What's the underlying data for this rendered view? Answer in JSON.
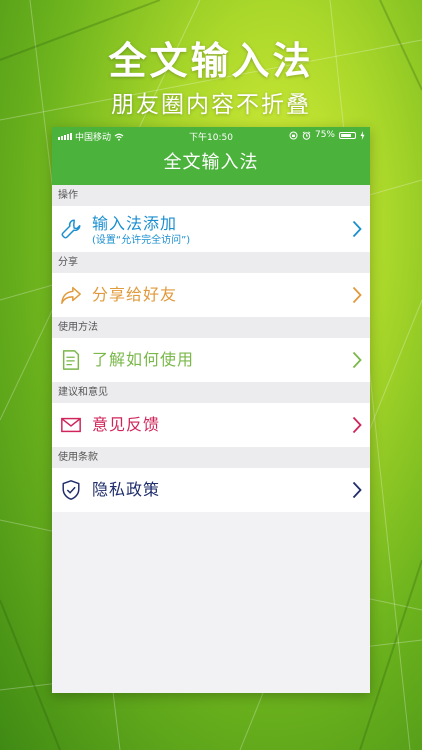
{
  "promo": {
    "title": "全文输入法",
    "subtitle": "朋友圈内容不折叠"
  },
  "status_bar": {
    "carrier": "中国移动",
    "time": "下午10:50",
    "battery": "75%"
  },
  "nav": {
    "title": "全文输入法"
  },
  "sections": [
    {
      "header": "操作",
      "item": {
        "label": "输入法添加",
        "sublabel": "(设置“允许完全访问”)",
        "color": "#1a8fd0",
        "icon": "wrench-icon"
      }
    },
    {
      "header": "分享",
      "item": {
        "label": "分享给好友",
        "color": "#e09a3c",
        "icon": "share-icon"
      }
    },
    {
      "header": "使用方法",
      "item": {
        "label": "了解如何使用",
        "color": "#7ab84a",
        "icon": "document-icon"
      }
    },
    {
      "header": "建议和意见",
      "item": {
        "label": "意见反馈",
        "color": "#d0245a",
        "icon": "envelope-icon"
      }
    },
    {
      "header": "使用条款",
      "item": {
        "label": "隐私政策",
        "color": "#1f2d6a",
        "icon": "shield-icon"
      }
    }
  ],
  "colors": {
    "nav_bar": "#4bb23c",
    "background": "#7cbf22"
  }
}
